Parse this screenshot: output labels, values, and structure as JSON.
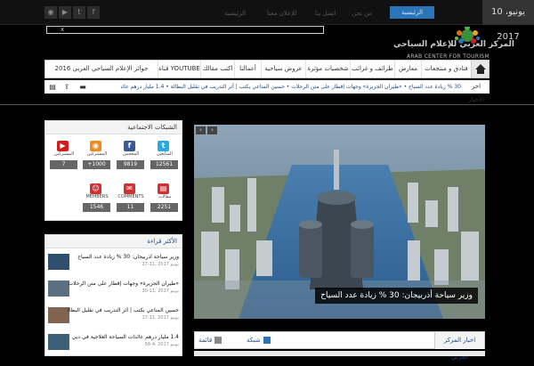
{
  "topbar": {
    "date": "10 يونيو، 2017",
    "home": "الرئيسية",
    "links": [
      "من نحن",
      "اتصل بنا",
      "للإعلان معنا",
      "الرئيسية"
    ],
    "social_icons": [
      "facebook-icon",
      "twitter-icon",
      "youtube-icon",
      "rss-icon"
    ]
  },
  "header": {
    "search_close": "x",
    "logo_ar": "المركز العربي للإعلام السياحي",
    "logo_en": "ARAB CENTER FOR TOURISM MEDIA"
  },
  "nav": {
    "items": [
      "فنادق و منتجعات",
      "معارض",
      "طرائف و غرائب",
      "شخصيات مؤثرة",
      "عروض سياحية",
      "أعمالنا",
      "اكتب مقالك",
      "قناة YOUTUBE",
      "جوائز الإعلام السياحي العربي 2016"
    ]
  },
  "ticker": {
    "label": "اخر الأخبار",
    "text": "30 % زيادة عدد السياح  •  «طيران الجزيرة» وجهات إقطار على متن الرحلات  •  حسين المناعي يكتب | أثر التدريب في تقليل البطالة  •  1.4 مليار درهم عائدات"
  },
  "slider": {
    "caption": "وزير سياحة أذربيجان: 30 % زيادة عدد السياح",
    "prev": "‹",
    "next": "›"
  },
  "news": {
    "title": "اخبار المركز العربي",
    "tab_grid": "شبكة",
    "tab_list": "قائمة"
  },
  "social": {
    "title": "الشبكات الاجتماعية",
    "cards": [
      {
        "label": "المتابعين",
        "count": "12561",
        "icon": "twitter-icon",
        "color": "#29a9e1"
      },
      {
        "label": "المعجبين",
        "count": "9819",
        "icon": "facebook-icon",
        "color": "#3b5998"
      },
      {
        "label": "المشتركين",
        "count": "+1000",
        "icon": "rss-icon",
        "color": "#f28a1b"
      },
      {
        "label": "المشتركين",
        "count": "7",
        "icon": "youtube-icon",
        "color": "#cc1f1f"
      },
      {
        "label": "مقالات",
        "count": "2251",
        "icon": "posts-icon",
        "color": "#d23131"
      },
      {
        "label": "COMMENTS",
        "count": "11",
        "icon": "comments-icon",
        "color": "#d23131"
      },
      {
        "label": "MEMBERS",
        "count": "1546",
        "icon": "members-icon",
        "color": "#d23131"
      }
    ]
  },
  "mostread": {
    "title": "الأكثر قراءة",
    "items": [
      {
        "title": "وزير سياحة أذربيجان: 30 % زيادة عدد السياح",
        "meta": "يونيو 2017 ,11-27"
      },
      {
        "title": "«طيران الجزيرة» وجهات إقطار على متن الرحلات",
        "meta": "يونيو 2017 ,11-30"
      },
      {
        "title": "حسين المناعي يكتب | أثر التدريب في تقليل البطالة",
        "meta": "يونيو 2017 ,11-17"
      },
      {
        "title": "1.4 مليار درهم عائدات السياحة العلاجية في دبي",
        "meta": "يونيو 2017 ,4-56"
      }
    ]
  }
}
